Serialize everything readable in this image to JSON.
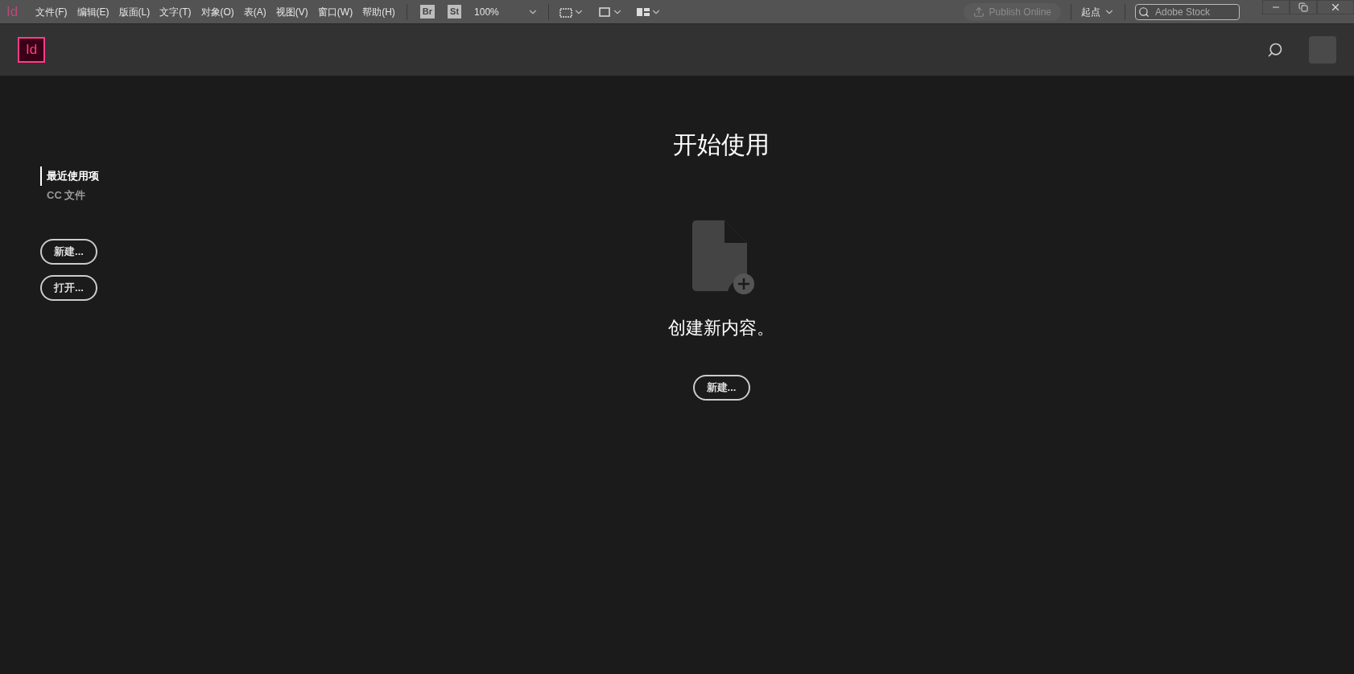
{
  "menu_bar": {
    "app_logo": "Id",
    "menus": [
      "文件(F)",
      "编辑(E)",
      "版面(L)",
      "文字(T)",
      "对象(O)",
      "表(A)",
      "视图(V)",
      "窗口(W)",
      "帮助(H)"
    ],
    "bridge_badge": "Br",
    "stock_badge": "St",
    "zoom": "100%",
    "publish": {
      "label": "Publish Online",
      "disabled": true
    },
    "workspace": "起点",
    "stock_search": {
      "placeholder": "Adobe Stock"
    }
  },
  "header": {
    "logo": "Id"
  },
  "sidebar": {
    "items": [
      {
        "label": "最近使用项",
        "selected": true
      },
      {
        "label": "CC 文件",
        "selected": false
      }
    ],
    "buttons": [
      "新建...",
      "打开..."
    ]
  },
  "main": {
    "title": "开始使用",
    "message": "创建新内容。",
    "button": "新建..."
  }
}
